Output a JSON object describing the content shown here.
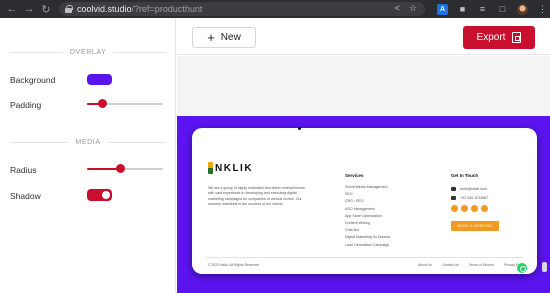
{
  "browser": {
    "url_host": "coolvid.studio",
    "url_path": "/?ref=producthunt",
    "back_icon": "arrow-left-icon",
    "forward_icon": "arrow-right-icon",
    "reload_icon": "reload-icon"
  },
  "panel": {
    "overlay_heading": "OVERLAY",
    "background_label": "Background",
    "background_color": "#5b14f0",
    "padding_label": "Padding",
    "padding_value": 0.2,
    "media_heading": "MEDIA",
    "radius_label": "Radius",
    "radius_value": 0.44,
    "shadow_label": "Shadow",
    "shadow_enabled": true
  },
  "toolbar": {
    "new_label": "New",
    "export_label": "Export"
  },
  "colors": {
    "accent": "#c8102e",
    "stage": "#5b14f0",
    "cta": "#f29a1f"
  },
  "preview": {
    "brand": "NKLIK",
    "about": "We are a group of highly motivated and driven entrepreneurs with vast experience in developing and executing digital marketing campaigns for companies of various niches. Our success manifests in the success of our clients.",
    "services_title": "Services",
    "services": [
      "Social Media Management",
      "SEO",
      "CRO / SEO",
      "ASO Management",
      "App Store Optimization",
      "Content Writing",
      "Chat Bot",
      "Digital Marketing for Doctors",
      "Lead Generation Campaign"
    ],
    "contact_title": "Get In Touch",
    "email": "hello@inklik.com",
    "phone": "+92 345 1234567",
    "cta_label": "BOOK A MEETING",
    "copyright": "© 2023 Inklik. All Rights Reserved",
    "legal_links": [
      "About Us",
      "Contact Us",
      "Terms of Service",
      "Privacy Policy"
    ]
  }
}
